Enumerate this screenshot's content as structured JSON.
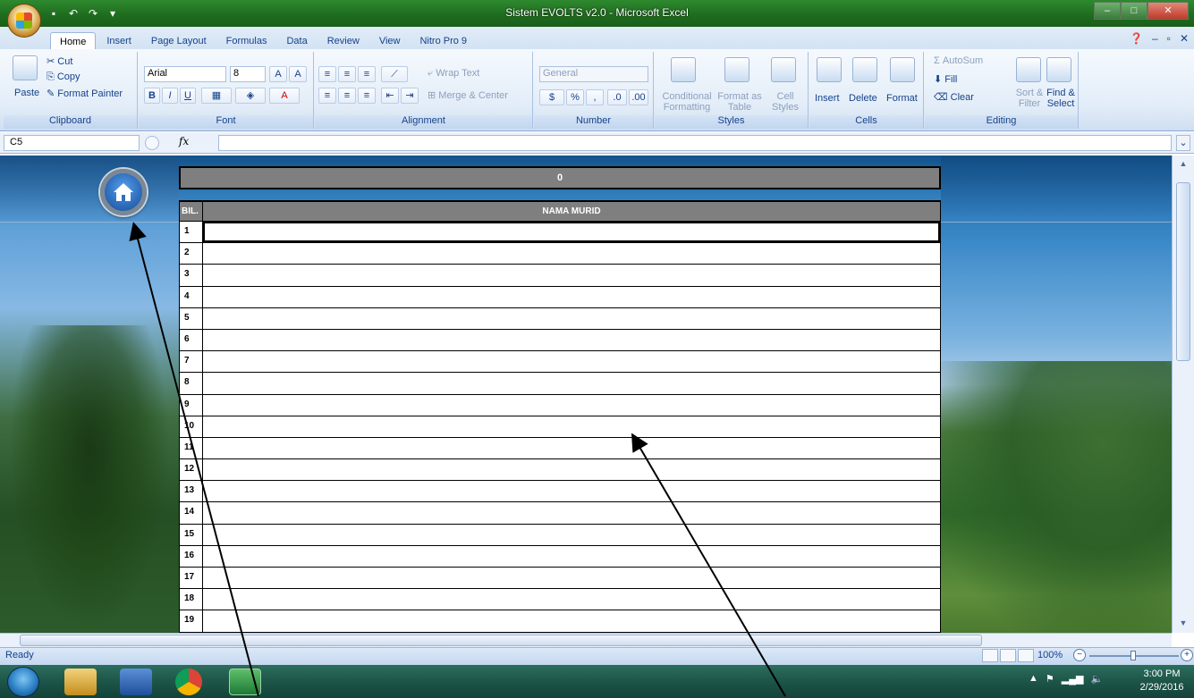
{
  "window": {
    "title": "Sistem EVOLTS v2.0 - Microsoft Excel"
  },
  "tabs": [
    "Home",
    "Insert",
    "Page Layout",
    "Formulas",
    "Data",
    "Review",
    "View",
    "Nitro Pro 9"
  ],
  "active_tab": "Home",
  "ribbon": {
    "clipboard": {
      "label": "Clipboard",
      "paste": "Paste",
      "cut": "Cut",
      "copy": "Copy",
      "format_painter": "Format Painter"
    },
    "font": {
      "label": "Font",
      "font_name": "Arial",
      "font_size": "8",
      "bold": "B",
      "italic": "I",
      "underline": "U"
    },
    "alignment": {
      "label": "Alignment",
      "wrap_text": "Wrap Text",
      "merge_center": "Merge & Center"
    },
    "number": {
      "label": "Number",
      "format": "General",
      "currency": "$",
      "percent": "%",
      "comma": ","
    },
    "styles": {
      "label": "Styles",
      "conditional": "Conditional Formatting",
      "format_table": "Format as Table",
      "cell_styles": "Cell Styles"
    },
    "cells": {
      "label": "Cells",
      "insert": "Insert",
      "delete": "Delete",
      "format": "Format"
    },
    "editing": {
      "label": "Editing",
      "autosum": "AutoSum",
      "fill": "Fill",
      "clear": "Clear",
      "sort_filter": "Sort & Filter",
      "find_select": "Find & Select"
    }
  },
  "formula_bar": {
    "name_box": "C5",
    "fx": "fx",
    "value": ""
  },
  "sheet": {
    "header_value": "0",
    "col_bil": "BIL.",
    "col_nama": "NAMA MURID",
    "rows": [
      "1",
      "2",
      "3",
      "4",
      "5",
      "6",
      "7",
      "8",
      "9",
      "10",
      "11",
      "12",
      "13",
      "14",
      "15",
      "16",
      "17",
      "18",
      "19"
    ]
  },
  "status": {
    "ready": "Ready",
    "zoom": "100%"
  },
  "taskbar": {
    "time": "3:00 PM",
    "date": "2/29/2016"
  },
  "icons": {
    "home": "home-icon",
    "office": "office-logo-icon"
  }
}
